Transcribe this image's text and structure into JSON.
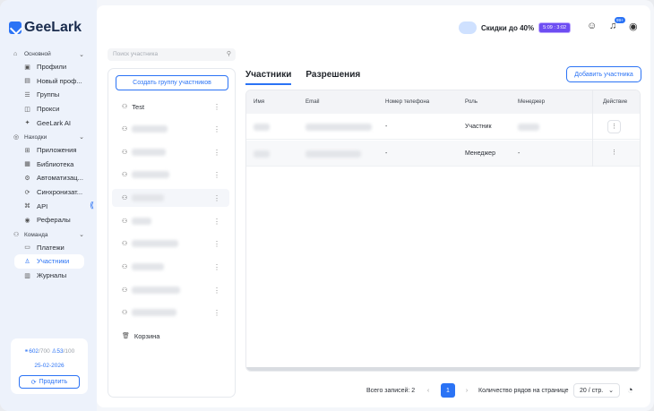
{
  "app": {
    "name": "GeeLark"
  },
  "sidebar": {
    "groups": [
      {
        "label": "Основной",
        "items": [
          "Профили",
          "Новый проф...",
          "Группы",
          "Прокси",
          "GeeLark AI"
        ]
      },
      {
        "label": "Находки",
        "items": [
          "Приложения",
          "Библиотека",
          "Автоматизац...",
          "Синхронизат...",
          "API",
          "Рефералы"
        ]
      },
      {
        "label": "Команда",
        "items": [
          "Платежи",
          "Участники",
          "Журналы"
        ]
      }
    ],
    "active_item": "Участники",
    "plan": {
      "phones_used": "602",
      "phones_total": "/700",
      "members_used": "53",
      "members_total": "/100",
      "date": "25-02-2026",
      "renew_label": "Продлить"
    }
  },
  "topbar": {
    "promo_text": "Скидки до 40%",
    "promo_timer": "5:09 : 3:02",
    "notification_badge": "99+"
  },
  "groups_panel": {
    "search_placeholder": "Поиск участника",
    "create_label": "Создать группу участников",
    "groups": [
      "Test",
      "",
      "",
      "",
      "",
      "",
      "",
      "",
      "",
      ""
    ],
    "trash_label": "Корзина"
  },
  "tabs": [
    "Участники",
    "Разрешения"
  ],
  "add_member_label": "Добавить участника",
  "table": {
    "columns": [
      "Имя",
      "Email",
      "Номер телефона",
      "Роль",
      "Менеджер",
      "Действие"
    ],
    "rows": [
      {
        "phone": "-",
        "role": "Участник",
        "manager": ""
      },
      {
        "phone": "-",
        "role": "Менеджер",
        "manager": "-"
      }
    ]
  },
  "pagination": {
    "total_label": "Всего записей: 2",
    "current_page": "1",
    "rows_label": "Количество рядов на странице",
    "page_size": "20 / стр."
  }
}
